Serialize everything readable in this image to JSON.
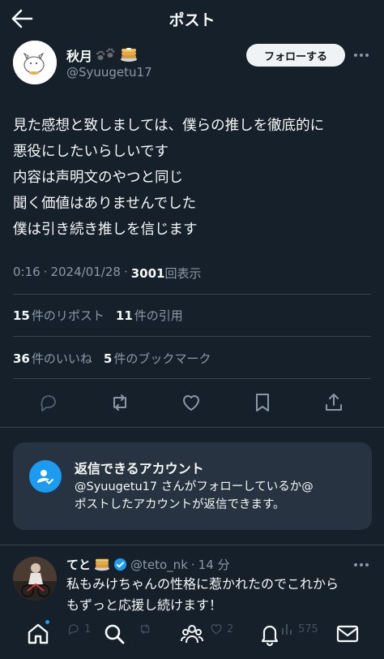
{
  "header": {
    "title": "ポスト",
    "back_icon": "arrow-left-icon"
  },
  "author": {
    "display_name": "秋月",
    "handle": "@Syuugetu17",
    "emoji": [
      "paw-prints-icon",
      "pancake-icon"
    ],
    "follow_label": "フォローする"
  },
  "post": {
    "lines": [
      "見た感想と致しましては、僕らの推しを徹底的に",
      "悪役にしたいらしいです",
      "内容は声明文のやつと同じ",
      "聞く価値はありませんでした",
      "僕は引き続き推しを信じます"
    ],
    "time": "0:16",
    "date": "2024/01/28",
    "views_count": "3001",
    "views_label": "回表示"
  },
  "stats": {
    "reposts_count": "15",
    "reposts_label": "件のリポスト",
    "quotes_count": "11",
    "quotes_label": "件の引用",
    "likes_count": "36",
    "likes_label": "件のいいね",
    "bookmarks_count": "5",
    "bookmarks_label": "件のブックマーク"
  },
  "reply_notice": {
    "title": "返信できるアカウント",
    "desc_line1": "@Syuugetu17 さんがフォローしているか@",
    "desc_line2": "ポストしたアカウントが返信できます。"
  },
  "reply": {
    "display_name": "てと",
    "handle": "@teto_nk",
    "time": "14 分",
    "text_line1": "私もみけちゃんの性格に惹かれたのでこれから",
    "text_line2": "もずっと応援し続けます！",
    "reply_count": "1",
    "like_count": "2",
    "view_count": "575"
  },
  "colors": {
    "background": "#15202b",
    "accent": "#1d9bf0",
    "muted": "#8b98a5",
    "card": "#273340"
  }
}
